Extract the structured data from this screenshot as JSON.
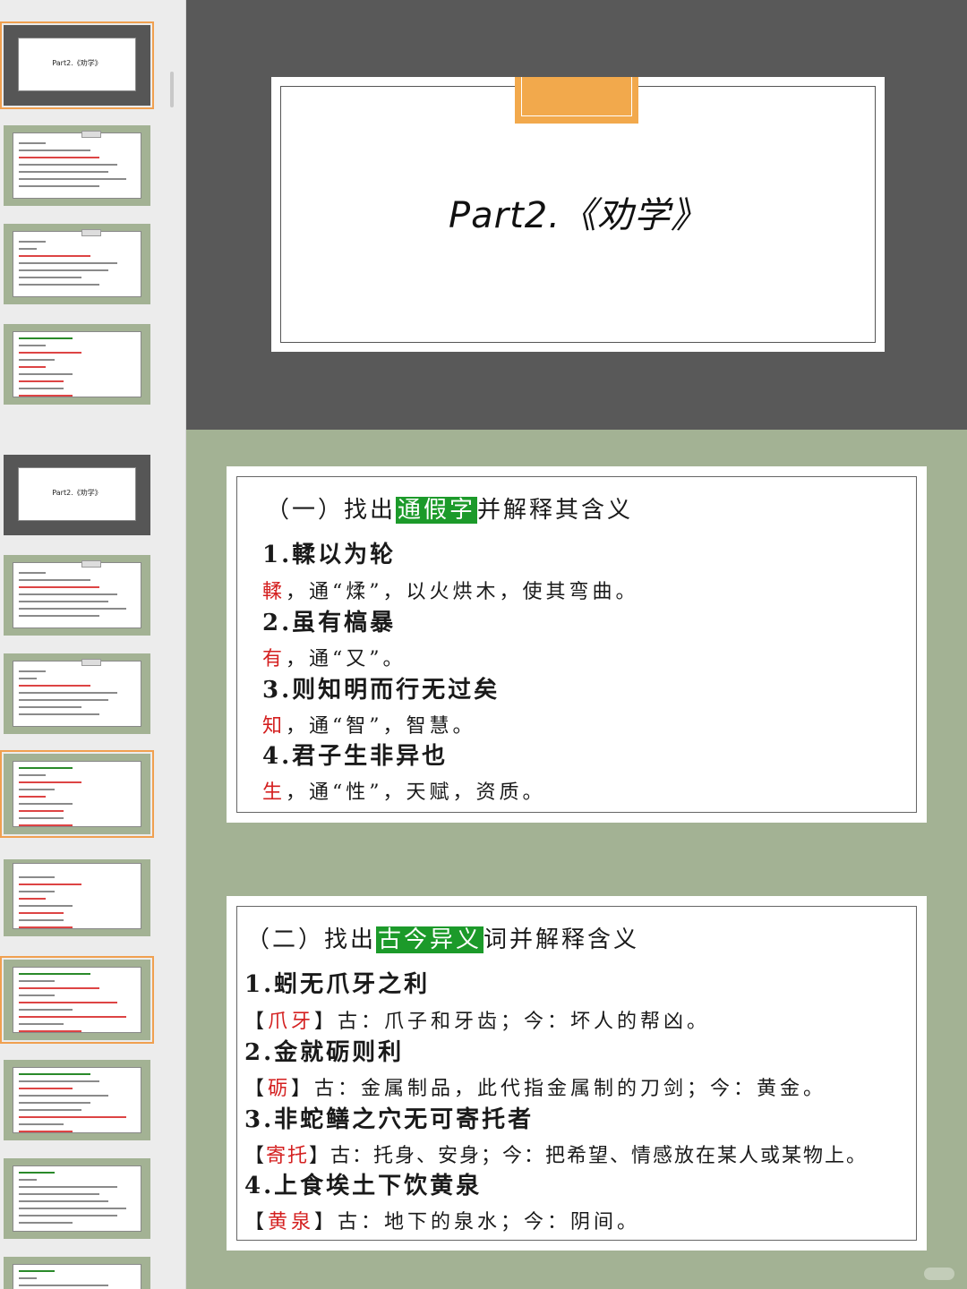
{
  "colors": {
    "accent": "#f2a94c",
    "highlight": "#1c9a2a",
    "red": "#d42020",
    "slide_bg_green": "#a3b294",
    "slide_bg_dark": "#595959"
  },
  "thumbnails": {
    "title_slide": "Part2.《劝学》"
  },
  "slide1": {
    "title": "Part2.《劝学》"
  },
  "slide2": {
    "heading_pre": "（一）找出",
    "heading_highlight": "通假字",
    "heading_post": "并解释其含义",
    "items": [
      {
        "title": "1.輮以为轮",
        "char": "輮",
        "rest": "，通“煣”，以火烘木，使其弯曲。"
      },
      {
        "title": "2.虽有槁暴",
        "char": "有",
        "rest": "，通“又”。"
      },
      {
        "title": "3.则知明而行无过矣",
        "char": "知",
        "rest": "，通“智”，智慧。"
      },
      {
        "title": "4.君子生非异也",
        "char": "生",
        "rest": "，通“性”，天赋，资质。"
      }
    ]
  },
  "slide3": {
    "heading_pre": "（二）找出",
    "heading_highlight": "古今异义",
    "heading_post": "词并解释含义",
    "items": [
      {
        "title": "1.蚓无爪牙之利",
        "open": "【",
        "word": "爪牙",
        "close": "】",
        "rest": "古：爪子和牙齿；今：坏人的帮凶。"
      },
      {
        "title": "2.金就砺则利",
        "open": "【",
        "word": "砺",
        "close": "】",
        "rest": "古：金属制品，此代指金属制的刀剑；今：黄金。"
      },
      {
        "title": "3.非蛇鳝之穴无可寄托者",
        "open": "【",
        "word": "寄托",
        "close": "】",
        "rest": "古：托身、安身；今：把希望、情感放在某人或某物上。"
      },
      {
        "title": "4.上食埃土下饮黄泉",
        "open": "【",
        "word": "黄泉",
        "close": "】",
        "rest": "古：地下的泉水；今：阴间。"
      }
    ]
  }
}
